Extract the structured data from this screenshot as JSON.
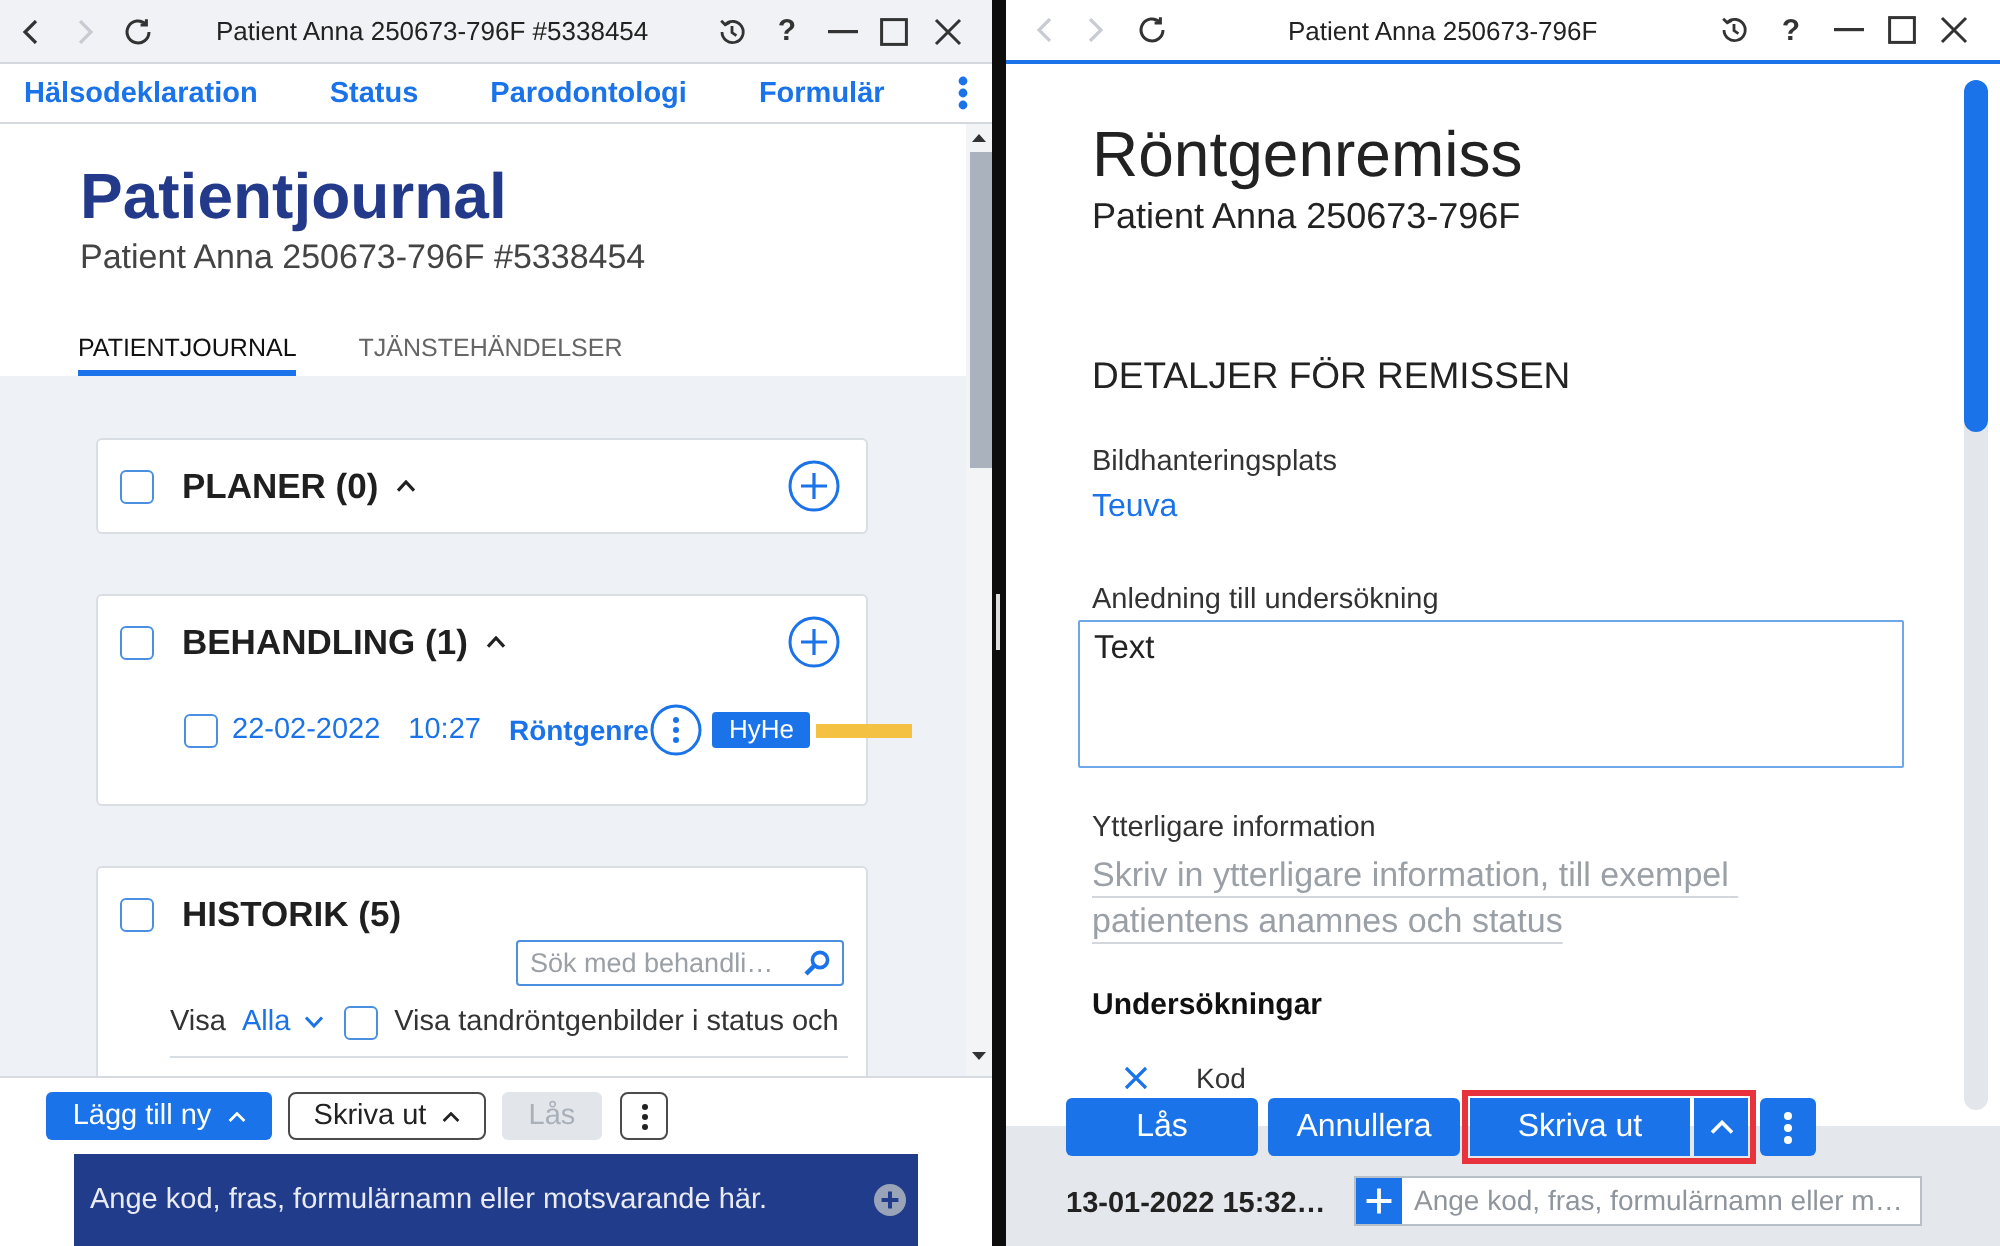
{
  "left_window": {
    "title_bar": {
      "title": "Patient Anna 250673-796F #5338454",
      "help": "?",
      "back": {
        "disabled": false
      },
      "forward": {
        "disabled": true
      }
    },
    "nav_links": [
      "Hälsodeklaration",
      "Status",
      "Parodontologi",
      "Formulär"
    ],
    "header": {
      "title": "Patientjournal",
      "subtitle": "Patient Anna 250673-796F #5338454"
    },
    "tabs": [
      {
        "label": "PATIENTJOURNAL",
        "selected": true
      },
      {
        "label": "TJÄNSTEHÄNDELSER",
        "selected": false
      }
    ],
    "sections": [
      {
        "kind": "group",
        "title": "PLANER (0)",
        "checked": false,
        "expanded": true
      },
      {
        "kind": "group",
        "title": "BEHANDLING (1)",
        "checked": false,
        "expanded": true,
        "entries": [
          {
            "checked": false,
            "date": "22-02-2022",
            "time": "10:27",
            "title": "Röntgenre",
            "badge": "HyHe"
          }
        ]
      },
      {
        "kind": "history",
        "title": "HISTORIK (5)",
        "checked": false,
        "search": {
          "placeholder": "Sök med behandli…"
        },
        "filter": {
          "label": "Visa",
          "value": "Alla"
        },
        "option": {
          "label": "Visa tandröntgenbilder i status och",
          "checked": false
        }
      }
    ],
    "toolbar": [
      {
        "label": "Lägg till ny",
        "kind": "primary",
        "menu": true,
        "disabled": false
      },
      {
        "label": "Skriva ut",
        "kind": "secondary",
        "menu": true,
        "disabled": false
      },
      {
        "label": "Lås",
        "kind": "secondary",
        "menu": false,
        "disabled": true
      }
    ],
    "command_field": {
      "placeholder": "Ange kod, fras, formulärnamn eller motsvarande här."
    }
  },
  "right_window": {
    "title_bar": {
      "title": "Patient Anna 250673-796F",
      "help": "?",
      "back": {
        "disabled": true
      },
      "forward": {
        "disabled": true
      }
    },
    "header": {
      "title": "Röntgenremiss",
      "subtitle": "Patient Anna 250673-796F"
    },
    "section_title": "DETALJER FÖR REMISSEN",
    "fields": [
      {
        "kind": "link",
        "label": "Bildhanteringsplats",
        "value": "Teuva"
      },
      {
        "kind": "textarea",
        "label": "Anledning till undersökning",
        "value": "Text"
      },
      {
        "kind": "notes",
        "label": "Ytterligare information",
        "placeholder": "Skriv in ytterligare information, till exempel patientens anamnes och status"
      }
    ],
    "examinations": {
      "title": "Undersökningar",
      "columns": [
        "Kod"
      ]
    },
    "actions": [
      {
        "label": "Lås",
        "kind": "button",
        "highlighted": false
      },
      {
        "label": "Annullera",
        "kind": "button",
        "highlighted": false
      },
      {
        "label": "Skriva ut",
        "kind": "split",
        "highlighted": true
      }
    ],
    "footer": {
      "timestamp": "13-01-2022 15:32…",
      "command_field": {
        "placeholder": "Ange kod, fras, formulärnamn eller m…"
      }
    }
  }
}
